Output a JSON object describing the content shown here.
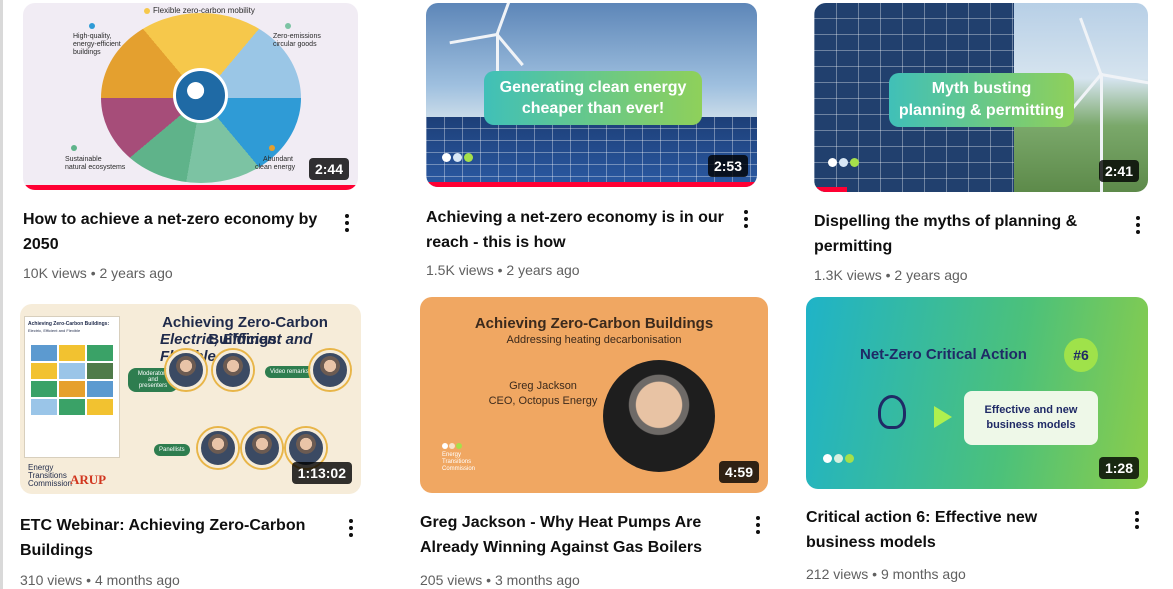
{
  "colors": {
    "progress": "#ff0033",
    "title": "#0f0f0f",
    "meta": "#606060"
  },
  "videos": [
    {
      "title_line1": "How to achieve a net-zero economy by",
      "title_line2": "2050",
      "views": "10K views",
      "age": "2 years ago",
      "duration": "2:44",
      "watched": 1.0,
      "thumb_text": {
        "top": "Flexible zero-carbon mobility",
        "left_top_1": "High-quality,",
        "left_top_2": "energy-efficient",
        "left_top_3": "buildings",
        "right_top_1": "Zero-emissions",
        "right_top_2": "circular goods",
        "left_bottom_1": "Sustainable",
        "left_bottom_2": "natural ecosystems",
        "right_bottom_1": "Abundant",
        "right_bottom_2": "clean energy"
      }
    },
    {
      "title_line1": "Achieving a net-zero economy is in our",
      "title_line2": "reach - this is how",
      "views": "1.5K views",
      "age": "2 years ago",
      "duration": "2:53",
      "watched": 1.0,
      "thumb_text": {
        "line1": "Generating clean energy",
        "line2": "cheaper than ever!"
      }
    },
    {
      "title_line1": "Dispelling the myths of planning &",
      "title_line2": "permitting",
      "views": "1.3K views",
      "age": "2 years ago",
      "duration": "2:41",
      "watched": 0.1,
      "thumb_text": {
        "line1": "Myth busting",
        "line2": "planning & permitting"
      }
    },
    {
      "title_line1": "ETC Webinar: Achieving Zero-Carbon",
      "title_line2": "Buildings",
      "views": "310 views",
      "age": "4 months ago",
      "duration": "1:13:02",
      "watched": 0,
      "thumb_text": {
        "headline": "Achieving Zero-Carbon Buildings:",
        "subline": "Electric, Efficient and Flexible",
        "doc_title": "Achieving Zero-Carbon Buildings:",
        "doc_sub": "Electric, Efficient and Flexible",
        "moderators": "Moderators and presenters",
        "video_remarks": "Video remarks",
        "panelists": "Panellists",
        "brand_1": "Energy",
        "brand_2": "Transitions",
        "brand_3": "Commission",
        "arup": "ARUP"
      }
    },
    {
      "title_line1": "Greg Jackson - Why Heat Pumps Are",
      "title_line2": "Already Winning Against Gas Boilers",
      "views": "205 views",
      "age": "3 months ago",
      "duration": "4:59",
      "watched": 0,
      "thumb_text": {
        "headline": "Achieving Zero-Carbon Buildings",
        "sub": "Addressing heating decarbonisation",
        "name": "Greg Jackson",
        "role": "CEO, Octopus Energy",
        "brand_1": "Energy",
        "brand_2": "Transitions",
        "brand_3": "Commission"
      }
    },
    {
      "title_line1": "Critical action 6: Effective new",
      "title_line2": "business models",
      "views": "212 views",
      "age": "9 months ago",
      "duration": "1:28",
      "watched": 0,
      "thumb_text": {
        "headline": "Net-Zero Critical Action",
        "badge": "#6",
        "box_1": "Effective and new",
        "box_2": "business models"
      }
    }
  ],
  "separator": "•"
}
